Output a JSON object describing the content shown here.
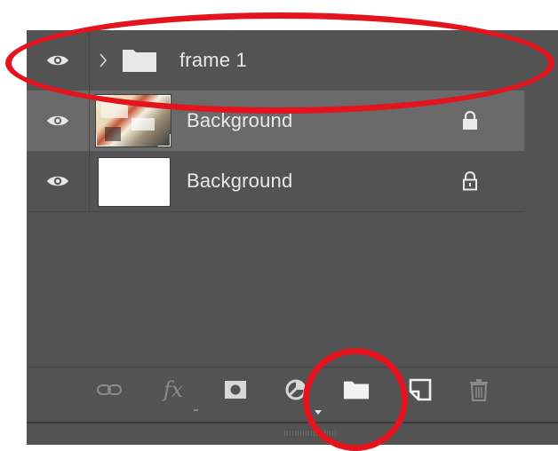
{
  "layers": [
    {
      "name": "frame 1",
      "type": "group",
      "visible": true,
      "selected": false,
      "locked": false
    },
    {
      "name": "Background",
      "type": "image",
      "visible": true,
      "selected": true,
      "locked": true
    },
    {
      "name": "Background",
      "type": "fill",
      "visible": true,
      "selected": false,
      "locked": true
    }
  ],
  "toolbar": {
    "icons": [
      "link-icon",
      "fx-icon",
      "mask-icon",
      "adjustment-icon",
      "new-group-folder-icon",
      "new-layer-icon",
      "trash-icon"
    ],
    "fx_label": "fx"
  },
  "colors": {
    "panel": "#535353",
    "selected_row": "#6a6a6a",
    "annotation": "#e3141d",
    "text": "#e8e8e8"
  }
}
